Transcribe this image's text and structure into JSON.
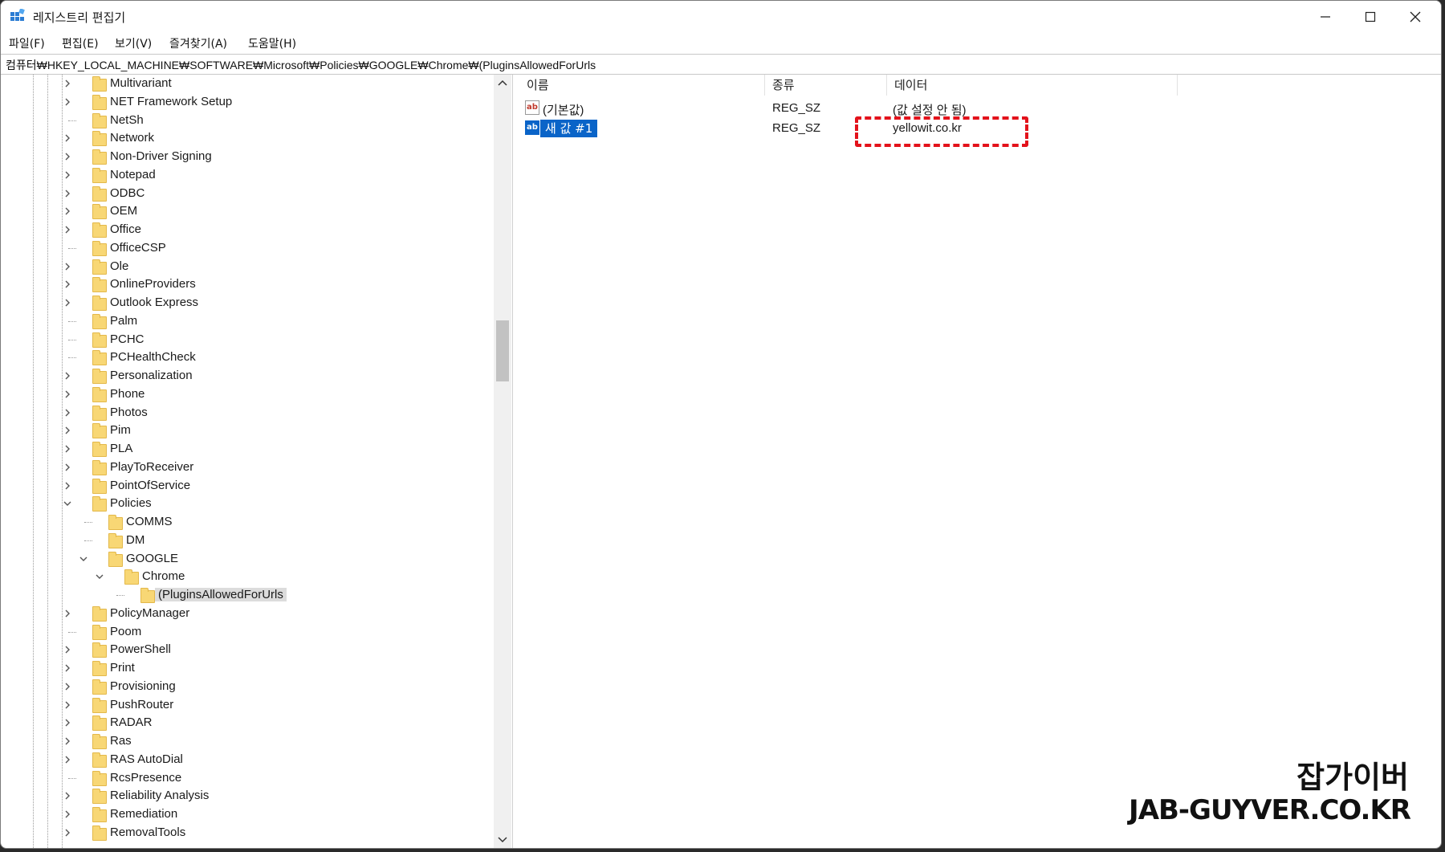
{
  "window": {
    "title": "레지스트리 편집기",
    "controls": {
      "minimize": "—",
      "maximize": "☐",
      "close": "✕"
    }
  },
  "menu": [
    {
      "label": "파일(F)"
    },
    {
      "label": "편집(E)"
    },
    {
      "label": "보기(V)"
    },
    {
      "label": "즐겨찾기(A)"
    },
    {
      "label": "도움말(H)"
    }
  ],
  "address": "컴퓨터₩HKEY_LOCAL_MACHINE₩SOFTWARE₩Microsoft₩Policies₩GOOGLE₩Chrome₩(PluginsAllowedForUrls",
  "tree": {
    "items": [
      {
        "label": "Multivariant",
        "level": 0,
        "expandable": true
      },
      {
        "label": "NET Framework Setup",
        "level": 0,
        "expandable": true
      },
      {
        "label": "NetSh",
        "level": 0,
        "expandable": false
      },
      {
        "label": "Network",
        "level": 0,
        "expandable": true
      },
      {
        "label": "Non-Driver Signing",
        "level": 0,
        "expandable": true
      },
      {
        "label": "Notepad",
        "level": 0,
        "expandable": true
      },
      {
        "label": "ODBC",
        "level": 0,
        "expandable": true
      },
      {
        "label": "OEM",
        "level": 0,
        "expandable": true
      },
      {
        "label": "Office",
        "level": 0,
        "expandable": true
      },
      {
        "label": "OfficeCSP",
        "level": 0,
        "expandable": false
      },
      {
        "label": "Ole",
        "level": 0,
        "expandable": true
      },
      {
        "label": "OnlineProviders",
        "level": 0,
        "expandable": true
      },
      {
        "label": "Outlook Express",
        "level": 0,
        "expandable": true
      },
      {
        "label": "Palm",
        "level": 0,
        "expandable": false
      },
      {
        "label": "PCHC",
        "level": 0,
        "expandable": false
      },
      {
        "label": "PCHealthCheck",
        "level": 0,
        "expandable": false
      },
      {
        "label": "Personalization",
        "level": 0,
        "expandable": true
      },
      {
        "label": "Phone",
        "level": 0,
        "expandable": true
      },
      {
        "label": "Photos",
        "level": 0,
        "expandable": true
      },
      {
        "label": "Pim",
        "level": 0,
        "expandable": true
      },
      {
        "label": "PLA",
        "level": 0,
        "expandable": true
      },
      {
        "label": "PlayToReceiver",
        "level": 0,
        "expandable": true
      },
      {
        "label": "PointOfService",
        "level": 0,
        "expandable": true
      },
      {
        "label": "Policies",
        "level": 0,
        "expandable": true,
        "expanded": true
      },
      {
        "label": "COMMS",
        "level": 1,
        "expandable": false
      },
      {
        "label": "DM",
        "level": 1,
        "expandable": false
      },
      {
        "label": "GOOGLE",
        "level": 1,
        "expandable": true,
        "expanded": true
      },
      {
        "label": "Chrome",
        "level": 2,
        "expandable": true,
        "expanded": true
      },
      {
        "label": "(PluginsAllowedForUrls",
        "level": 3,
        "expandable": false,
        "selected": true
      },
      {
        "label": "PolicyManager",
        "level": 0,
        "expandable": true
      },
      {
        "label": "Poom",
        "level": 0,
        "expandable": false
      },
      {
        "label": "PowerShell",
        "level": 0,
        "expandable": true
      },
      {
        "label": "Print",
        "level": 0,
        "expandable": true
      },
      {
        "label": "Provisioning",
        "level": 0,
        "expandable": true
      },
      {
        "label": "PushRouter",
        "level": 0,
        "expandable": true
      },
      {
        "label": "RADAR",
        "level": 0,
        "expandable": true
      },
      {
        "label": "Ras",
        "level": 0,
        "expandable": true
      },
      {
        "label": "RAS AutoDial",
        "level": 0,
        "expandable": true
      },
      {
        "label": "RcsPresence",
        "level": 0,
        "expandable": false
      },
      {
        "label": "Reliability Analysis",
        "level": 0,
        "expandable": true
      },
      {
        "label": "Remediation",
        "level": 0,
        "expandable": true
      },
      {
        "label": "RemovalTools",
        "level": 0,
        "expandable": true
      }
    ]
  },
  "list": {
    "headers": {
      "name": "이름",
      "type": "종류",
      "data": "데이터"
    },
    "rows": [
      {
        "icon": "ab",
        "name": "(기본값)",
        "type": "REG_SZ",
        "data": "(값 설정 안 됨)",
        "selected": false
      },
      {
        "icon": "ab",
        "name": "새 값 #1",
        "type": "REG_SZ",
        "data": "yellowit.co.kr",
        "selected": true
      }
    ]
  },
  "watermark": {
    "korean": "잡가이버",
    "site": "JAB-GUYVER.CO.KR"
  },
  "colors": {
    "selection": "#0a64c8",
    "callout": "#e3121b",
    "folder": "#f8d775"
  }
}
